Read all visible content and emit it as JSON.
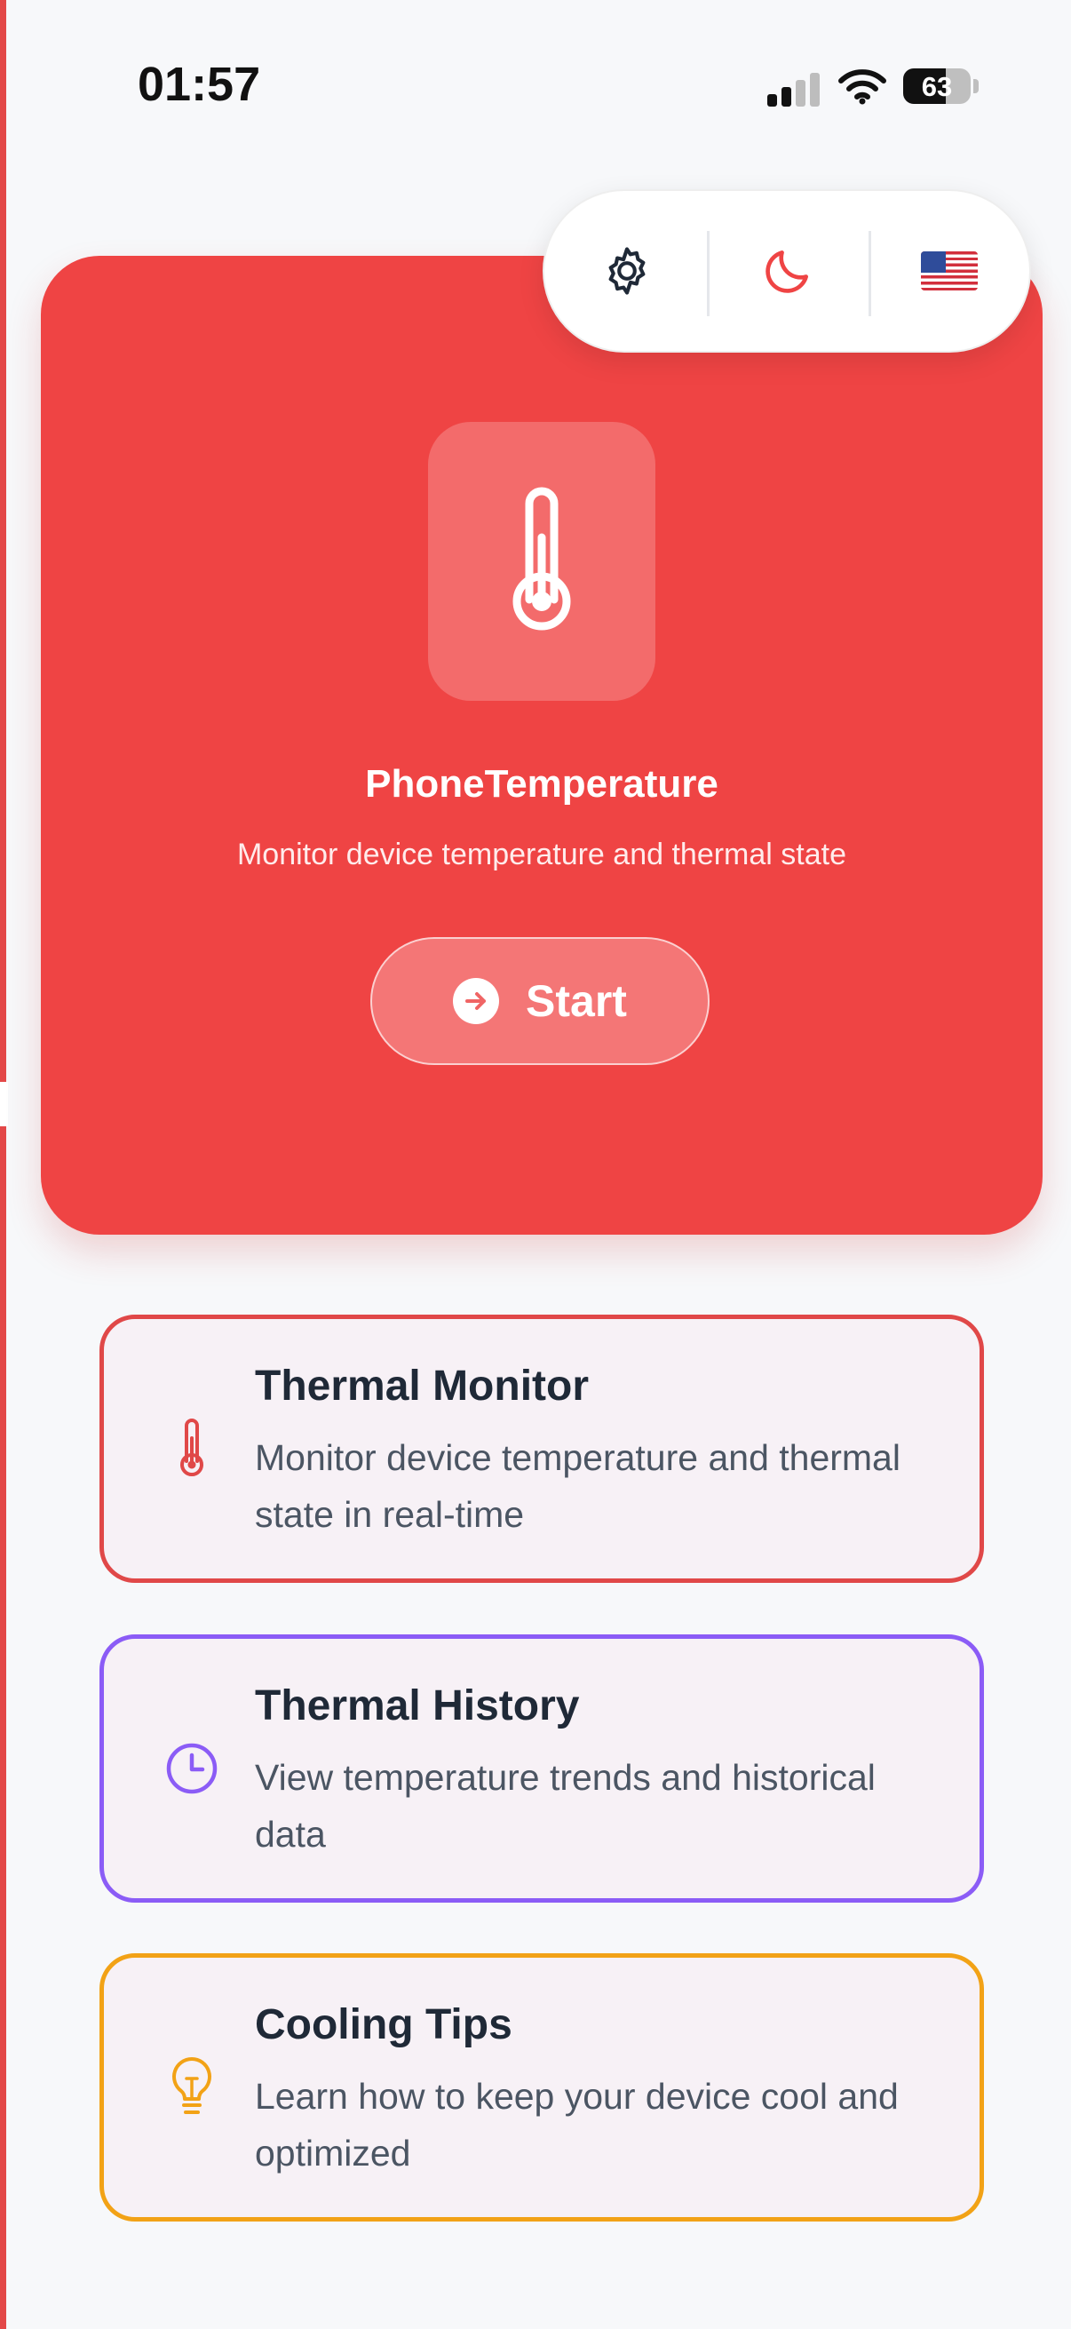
{
  "status_bar": {
    "time": "01:57",
    "battery": "63",
    "icons": [
      "signal-icon",
      "wifi-icon",
      "battery-icon"
    ]
  },
  "toolbar": {
    "icons": [
      "gear-icon",
      "moon-icon",
      "us-flag-icon"
    ]
  },
  "hero": {
    "icon": "thermometer-icon",
    "title": "PhoneTemperature",
    "subtitle": "Monitor device temperature and thermal state",
    "start_label": "Start",
    "start_icon": "arrow-right-circle-icon"
  },
  "features": [
    {
      "title": "Thermal Monitor",
      "description": "Monitor device temperature and thermal state in real-time",
      "icon": "thermometer-icon",
      "color": "#e04848"
    },
    {
      "title": "Thermal History",
      "description": "View temperature trends and historical data",
      "icon": "clock-icon",
      "color": "#8b5cf6"
    },
    {
      "title": "Cooling Tips",
      "description": "Learn how to keep your device cool and optimized",
      "icon": "lightbulb-icon",
      "color": "#f2a216"
    }
  ],
  "colors": {
    "primary": "#ef4444",
    "background": "#f7f8fa"
  }
}
